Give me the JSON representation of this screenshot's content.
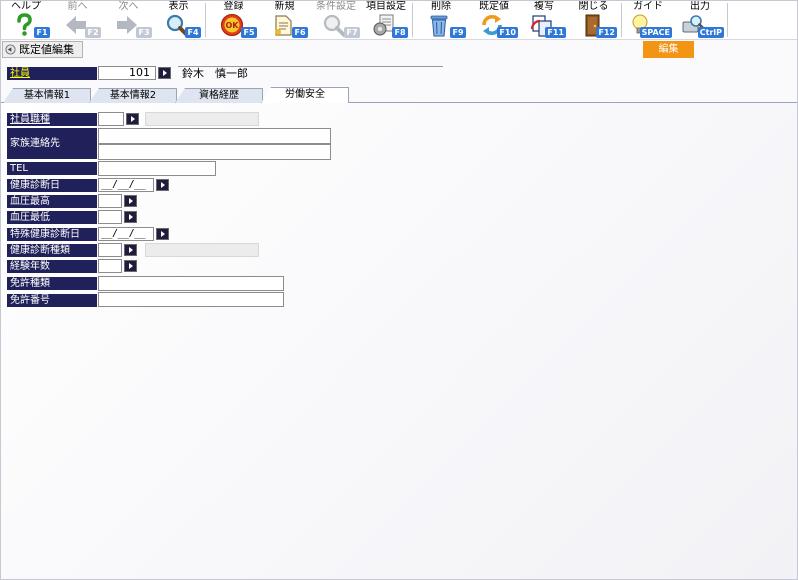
{
  "toolbar": {
    "buttons": [
      {
        "label": "ヘルプ",
        "fkey": "F1",
        "icon": "help-icon",
        "enabled": true
      },
      {
        "label": "前へ",
        "fkey": "F2",
        "icon": "arrow-left-icon",
        "enabled": false
      },
      {
        "label": "次へ",
        "fkey": "F3",
        "icon": "arrow-right-icon",
        "enabled": false
      },
      {
        "label": "表示",
        "fkey": "F4",
        "icon": "magnifier-icon",
        "enabled": true
      },
      {
        "label": "登録",
        "fkey": "F5",
        "icon": "ok-icon",
        "enabled": true
      },
      {
        "label": "新規",
        "fkey": "F6",
        "icon": "new-document-icon",
        "enabled": true
      },
      {
        "label": "条件設定",
        "fkey": "F7",
        "icon": "condition-magnifier-icon",
        "enabled": false
      },
      {
        "label": "項目設定",
        "fkey": "F8",
        "icon": "items-settings-icon",
        "enabled": true
      },
      {
        "label": "削除",
        "fkey": "F9",
        "icon": "trash-icon",
        "enabled": true
      },
      {
        "label": "既定値",
        "fkey": "F10",
        "icon": "refresh-icon",
        "enabled": true
      },
      {
        "label": "複写",
        "fkey": "F11",
        "icon": "copy-icon",
        "enabled": true
      },
      {
        "label": "閉じる",
        "fkey": "F12",
        "icon": "close-door-icon",
        "enabled": true
      },
      {
        "label": "ガイド",
        "fkey": "SPACE",
        "icon": "lightbulb-icon",
        "enabled": true
      },
      {
        "label": "出力",
        "fkey": "CtrlP",
        "icon": "output-magnifier-icon",
        "enabled": true
      }
    ]
  },
  "header": {
    "title": "既定値編集",
    "status_badge": "編集"
  },
  "employee": {
    "label": "社員",
    "code": "101",
    "name": "鈴木　慎一郎"
  },
  "tabs": [
    {
      "label": "基本情報1",
      "active": false
    },
    {
      "label": "基本情報2",
      "active": false
    },
    {
      "label": "資格経歴",
      "active": false
    },
    {
      "label": "労働安全",
      "active": true
    }
  ],
  "form": {
    "occupation_label": "社員職種",
    "family_contact_label": "家族連絡先",
    "tel_label": "TEL",
    "health_check_date_label": "健康診断日",
    "health_check_date_value": "__/__/__",
    "bp_high_label": "血圧最高",
    "bp_low_label": "血圧最低",
    "special_check_date_label": "特殊健康診断日",
    "special_check_date_value": "__/__/__",
    "health_check_type_label": "健康診断種類",
    "experience_years_label": "経験年数",
    "license_type_label": "免許種類",
    "license_number_label": "免許番号"
  },
  "colors": {
    "label_bg": "#20205a",
    "link_text": "#ffff00",
    "fkey_bg": "#2f78d8",
    "badge_bg": "#f29414",
    "tab_bg": "#dfe5f0"
  }
}
